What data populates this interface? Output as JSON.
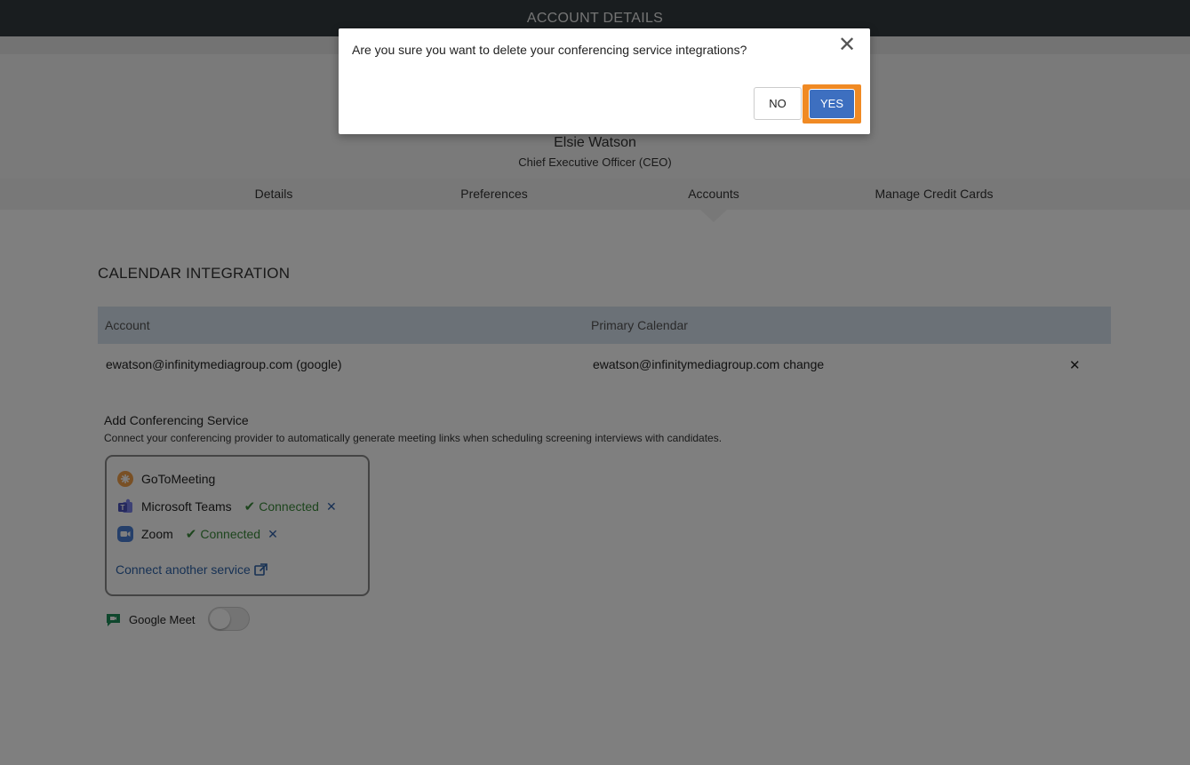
{
  "header": {
    "title": "ACCOUNT DETAILS"
  },
  "profile": {
    "name": "Elsie Watson",
    "title": "Chief Executive Officer (CEO)"
  },
  "tabs": [
    {
      "label": "Details"
    },
    {
      "label": "Preferences"
    },
    {
      "label": "Accounts",
      "active": true
    },
    {
      "label": "Manage Credit Cards"
    }
  ],
  "calendar": {
    "section_title": "CALENDAR INTEGRATION",
    "columns": [
      "Account",
      "Primary Calendar"
    ],
    "rows": [
      {
        "account": "ewatson@infinitymediagroup.com (google)",
        "primary_calendar": "ewatson@infinitymediagroup.com change"
      }
    ]
  },
  "conferencing": {
    "title": "Add Conferencing Service",
    "description": "Connect your conferencing provider to automatically generate meeting links when scheduling screening interviews with candidates.",
    "services": [
      {
        "name": "GoToMeeting",
        "icon": "gotomeeting-icon",
        "status": ""
      },
      {
        "name": "Microsoft Teams",
        "icon": "teams-icon",
        "status": "Connected"
      },
      {
        "name": "Zoom",
        "icon": "zoom-icon",
        "status": "Connected"
      }
    ],
    "connect_link": "Connect another service",
    "google_meet": {
      "label": "Google Meet",
      "enabled": false
    }
  },
  "modal": {
    "message": "Are you sure you want to delete your conferencing service integrations?",
    "no_label": "NO",
    "yes_label": "YES"
  },
  "colors": {
    "header_bg": "#333b3f",
    "accent_blue": "#3d6fc0",
    "highlight_orange": "#f08a24",
    "connected_green": "#3a8a3a"
  }
}
